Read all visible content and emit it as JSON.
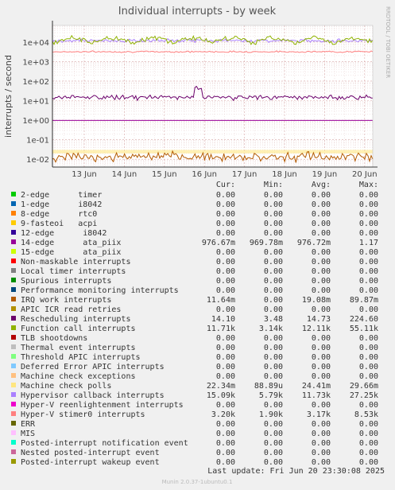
{
  "chart_data": {
    "type": "line",
    "title": "Individual interrupts - by week",
    "ylabel": "interrupts / second",
    "side_label": "RRDTOOL / TOBI OETIKER",
    "yscale": "log",
    "ylim": [
      0.004,
      70000
    ],
    "y_ticks": [
      {
        "value": 10000,
        "label": "1e+04"
      },
      {
        "value": 1000,
        "label": "1e+03"
      },
      {
        "value": 100,
        "label": "1e+02"
      },
      {
        "value": 10,
        "label": "1e+01"
      },
      {
        "value": 1,
        "label": "1e+00"
      },
      {
        "value": 0.1,
        "label": "1e-01"
      },
      {
        "value": 0.01,
        "label": "1e-02"
      }
    ],
    "x_ticks": [
      "13 Jun",
      "14 Jun",
      "15 Jun",
      "16 Jun",
      "17 Jun",
      "18 Jun",
      "19 Jun",
      "20 Jun"
    ],
    "grid": true,
    "table_header": {
      "cur": "Cur:",
      "min": "Min:",
      "avg": "Avg:",
      "max": "Max:"
    },
    "series": [
      {
        "name": "2-edge      timer",
        "color": "#00cc00",
        "cur": "0.00",
        "min": "0.00",
        "avg": "0.00",
        "max": "0.00"
      },
      {
        "name": "1-edge      i8042",
        "color": "#0066b3",
        "cur": "0.00",
        "min": "0.00",
        "avg": "0.00",
        "max": "0.00"
      },
      {
        "name": "8-edge      rtc0",
        "color": "#ff8000",
        "cur": "0.00",
        "min": "0.00",
        "avg": "0.00",
        "max": "0.00"
      },
      {
        "name": "9-fasteoi   acpi",
        "color": "#ffcc00",
        "cur": "0.00",
        "min": "0.00",
        "avg": "0.00",
        "max": "0.00"
      },
      {
        "name": "12-edge      i8042",
        "color": "#330099",
        "cur": "0.00",
        "min": "0.00",
        "avg": "0.00",
        "max": "0.00"
      },
      {
        "name": "14-edge      ata_piix",
        "color": "#990099",
        "cur": "976.67m",
        "min": "969.78m",
        "avg": "976.72m",
        "max": "1.17"
      },
      {
        "name": "15-edge      ata_piix",
        "color": "#ccff00",
        "cur": "0.00",
        "min": "0.00",
        "avg": "0.00",
        "max": "0.00"
      },
      {
        "name": "Non-maskable interrupts",
        "color": "#ff0000",
        "cur": "0.00",
        "min": "0.00",
        "avg": "0.00",
        "max": "0.00"
      },
      {
        "name": "Local timer interrupts",
        "color": "#808080",
        "cur": "0.00",
        "min": "0.00",
        "avg": "0.00",
        "max": "0.00"
      },
      {
        "name": "Spurious interrupts",
        "color": "#008f00",
        "cur": "0.00",
        "min": "0.00",
        "avg": "0.00",
        "max": "0.00"
      },
      {
        "name": "Performance monitoring interrupts",
        "color": "#00487d",
        "cur": "0.00",
        "min": "0.00",
        "avg": "0.00",
        "max": "0.00"
      },
      {
        "name": "IRQ work interrupts",
        "color": "#b35a00",
        "cur": "11.64m",
        "min": "0.00",
        "avg": "19.08m",
        "max": "89.87m"
      },
      {
        "name": "APIC ICR read retries",
        "color": "#b38f00",
        "cur": "0.00",
        "min": "0.00",
        "avg": "0.00",
        "max": "0.00"
      },
      {
        "name": "Rescheduling interrupts",
        "color": "#6b006b",
        "cur": "14.10",
        "min": "3.48",
        "avg": "14.73",
        "max": "224.60"
      },
      {
        "name": "Function call interrupts",
        "color": "#8fb300",
        "cur": "11.71k",
        "min": "3.14k",
        "avg": "12.11k",
        "max": "55.11k"
      },
      {
        "name": "TLB shootdowns",
        "color": "#b30000",
        "cur": "0.00",
        "min": "0.00",
        "avg": "0.00",
        "max": "0.00"
      },
      {
        "name": "Thermal event interrupts",
        "color": "#bebebe",
        "cur": "0.00",
        "min": "0.00",
        "avg": "0.00",
        "max": "0.00"
      },
      {
        "name": "Threshold APIC interrupts",
        "color": "#80ff80",
        "cur": "0.00",
        "min": "0.00",
        "avg": "0.00",
        "max": "0.00"
      },
      {
        "name": "Deferred Error APIC interrupts",
        "color": "#80c9ff",
        "cur": "0.00",
        "min": "0.00",
        "avg": "0.00",
        "max": "0.00"
      },
      {
        "name": "Machine check exceptions",
        "color": "#ffc080",
        "cur": "0.00",
        "min": "0.00",
        "avg": "0.00",
        "max": "0.00"
      },
      {
        "name": "Machine check polls",
        "color": "#ffe680",
        "cur": "22.34m",
        "min": "88.89u",
        "avg": "24.41m",
        "max": "29.66m"
      },
      {
        "name": "Hypervisor callback interrupts",
        "color": "#aa80ff",
        "cur": "15.09k",
        "min": "5.79k",
        "avg": "11.73k",
        "max": "27.25k"
      },
      {
        "name": "Hyper-V reenlightenment interrupts",
        "color": "#ee00cc",
        "cur": "0.00",
        "min": "0.00",
        "avg": "0.00",
        "max": "0.00"
      },
      {
        "name": "Hyper-V stimer0 interrupts",
        "color": "#ff8080",
        "cur": "3.20k",
        "min": "1.90k",
        "avg": "3.17k",
        "max": "8.53k"
      },
      {
        "name": "ERR",
        "color": "#666600",
        "cur": "0.00",
        "min": "0.00",
        "avg": "0.00",
        "max": "0.00"
      },
      {
        "name": "MIS",
        "color": "#ffbfff",
        "cur": "0.00",
        "min": "0.00",
        "avg": "0.00",
        "max": "0.00"
      },
      {
        "name": "Posted-interrupt notification event",
        "color": "#00ffcc",
        "cur": "0.00",
        "min": "0.00",
        "avg": "0.00",
        "max": "0.00"
      },
      {
        "name": "Nested posted-interrupt event",
        "color": "#cc6699",
        "cur": "0.00",
        "min": "0.00",
        "avg": "0.00",
        "max": "0.00"
      },
      {
        "name": "Posted-interrupt wakeup event",
        "color": "#999900",
        "cur": "0.00",
        "min": "0.00",
        "avg": "0.00",
        "max": "0.00"
      }
    ],
    "last_update": "Last update: Fri Jun 20 23:30:08 2025",
    "footer": "Munin 2.0.37-1ubuntu0.1"
  }
}
